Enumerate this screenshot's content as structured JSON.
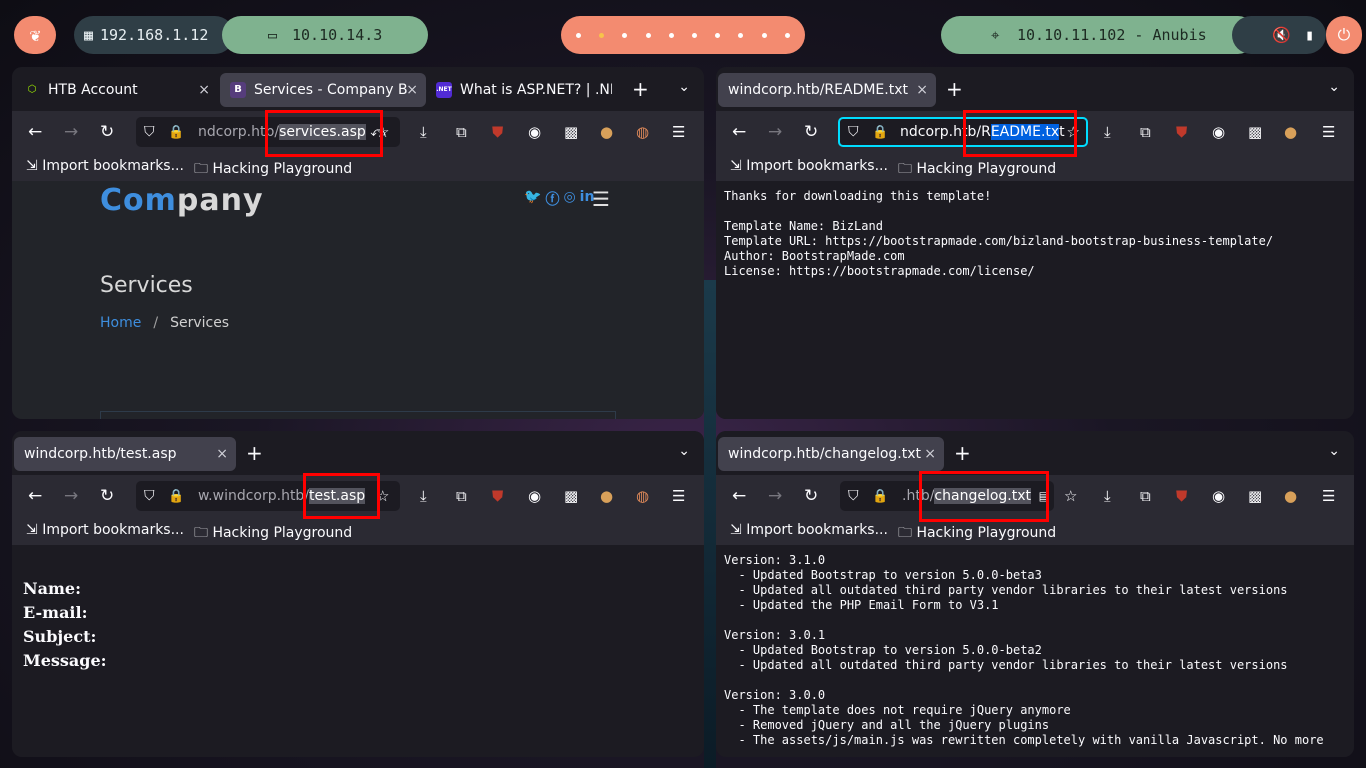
{
  "topbar": {
    "ip_local": "192.168.1.12",
    "ip_vpn": "10.10.14.3",
    "target": "10.10.11.102 - Anubis",
    "workspaces": [
      false,
      true,
      false,
      false,
      false,
      false,
      false,
      false,
      false,
      false
    ],
    "colors": {
      "coral": "#f38b70",
      "green": "#7fb28f",
      "dark": "#2f3e46"
    }
  },
  "windows": {
    "top_left": {
      "tabs": [
        {
          "label": "HTB Account",
          "favicon": "htb-icon",
          "active": false
        },
        {
          "label": "Services - Company B",
          "favicon": "bootstrap-icon",
          "active": true
        },
        {
          "label": "What is ASP.NET? | .NE",
          "favicon": "dotnet-icon",
          "active": false
        }
      ],
      "url_prefix": "ndcorp.htb/",
      "url_selected": "services.asp",
      "url_suffix": " ⤺",
      "bookmarks": [
        "Import bookmarks...",
        "Hacking Playground"
      ],
      "page": {
        "brand_a": "Com",
        "brand_b": "pany",
        "title": "Services",
        "crumb_home": "Home",
        "crumb_sep": "/",
        "crumb_current": "Services"
      }
    },
    "top_right": {
      "tabs": [
        {
          "label": "windcorp.htb/README.txt",
          "active": true
        }
      ],
      "url_prefix": "ndcorp.htb/R",
      "url_selected": "EADME.tx",
      "url_suffix": "t",
      "bookmarks": [
        "Import bookmarks...",
        "Hacking Playground"
      ],
      "page_text": "Thanks for downloading this template!\n\nTemplate Name: BizLand\nTemplate URL: https://bootstrapmade.com/bizland-bootstrap-business-template/\nAuthor: BootstrapMade.com\nLicense: https://bootstrapmade.com/license/"
    },
    "bottom_left": {
      "tabs": [
        {
          "label": "windcorp.htb/test.asp",
          "active": true
        }
      ],
      "url_prefix": "w.windcorp.htb/",
      "url_selected": "test.asp",
      "url_suffix": "",
      "bookmarks": [
        "Import bookmarks...",
        "Hacking Playground"
      ],
      "form_labels": [
        "Name:",
        "E-mail:",
        "Subject:",
        "Message:"
      ]
    },
    "bottom_right": {
      "tabs": [
        {
          "label": "windcorp.htb/changelog.txt",
          "active": true
        }
      ],
      "url_prefix": ".htb/",
      "url_selected": "changelog.txt",
      "url_suffix": "",
      "bookmarks": [
        "Import bookmarks...",
        "Hacking Playground"
      ],
      "page_text": "Version: 3.1.0\n  - Updated Bootstrap to version 5.0.0-beta3\n  - Updated all outdated third party vendor libraries to their latest versions\n  - Updated the PHP Email Form to V3.1\n\nVersion: 3.0.1\n  - Updated Bootstrap to version 5.0.0-beta2\n  - Updated all outdated third party vendor libraries to their latest versions\n\nVersion: 3.0.0\n  - The template does not require jQuery anymore\n  - Removed jQuery and all the jQuery plugins\n  - The assets/js/main.js was rewritten completely with vanilla Javascript. No more"
    }
  },
  "icons": {
    "close": "×",
    "new_tab": "+",
    "list_all": "⌄",
    "back": "←",
    "forward": "→",
    "reload": "↻",
    "shield": "⛉",
    "lock": "🔒",
    "star": "☆",
    "download": "⤓",
    "extensions": "⧉",
    "menu": "☰",
    "import": "⇲",
    "folder": "🗀"
  }
}
